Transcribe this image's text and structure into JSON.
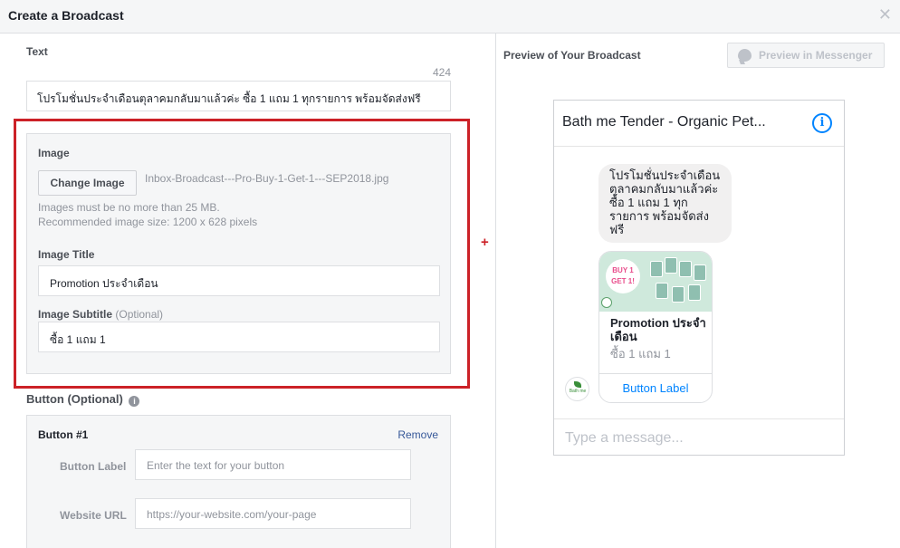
{
  "dialog": {
    "title": "Create a Broadcast",
    "close_icon": "close-icon"
  },
  "form": {
    "text": {
      "label": "Text",
      "char_count": "424",
      "value": "โปรโมชั่นประจำเดือนตุลาคมกลับมาแล้วค่ะ ซื้อ 1 แถม 1 ทุกรายการ พร้อมจัดส่งฟรี"
    },
    "image": {
      "label": "Image",
      "change_button": "Change Image",
      "filename": "Inbox-Broadcast---Pro-Buy-1-Get-1---SEP2018.jpg",
      "note_size": "Images must be no more than 25 MB.",
      "note_recommended": "Recommended image size: 1200 x 628 pixels",
      "title_label": "Image Title",
      "title_value": "Promotion ประจำเดือน",
      "subtitle_label": "Image Subtitle",
      "subtitle_optional": "(Optional)",
      "subtitle_value": "ซื้อ 1 แถม 1"
    },
    "highlight_color": "#cc2127",
    "plus_symbol": "+",
    "button_section": {
      "label": "Button (Optional)",
      "info_icon": "info-icon",
      "card_title": "Button #1",
      "remove": "Remove",
      "label_field_label": "Button Label",
      "label_placeholder": "Enter the text for your button",
      "url_field_label": "Website URL",
      "url_placeholder": "https://your-website.com/your-page"
    }
  },
  "preview": {
    "title": "Preview of Your Broadcast",
    "messenger_button": "Preview in Messenger",
    "messenger_icon": "messenger-icon",
    "page_name": "Bath me Tender - Organic Pet...",
    "info_icon": "info-icon",
    "info_glyph": "i",
    "message": "โปรโมชั่นประจำเดือนตุลาคมกลับมาแล้วค่ะ ซื้อ 1 แถม 1 ทุกรายการ พร้อมจัดส่งฟรี",
    "card": {
      "image_badge_line1": "BUY 1",
      "image_badge_line2": "GET 1!",
      "title": "Promotion ประจำเดือน",
      "subtitle": "ซื้อ 1 แถม 1",
      "button": "Button Label"
    },
    "avatar_text": "Bath me",
    "compose_placeholder": "Type a message...",
    "accent_color": "#0084ff"
  }
}
